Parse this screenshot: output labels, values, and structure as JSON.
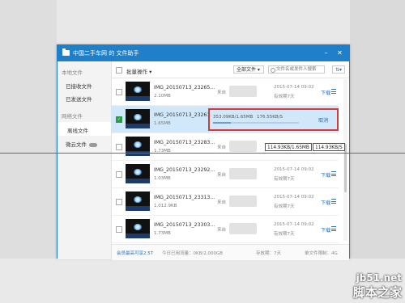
{
  "window": {
    "title": "中国二手车网 的 文件助手"
  },
  "sidebar": {
    "section_local": "本地文件",
    "received": "已接收文件",
    "sent": "已发送文件",
    "section_network": "网络文件",
    "offline": "离线文件",
    "cloud": "微云文件"
  },
  "toolbar": {
    "batch": "批量操作",
    "filter": "全部文件",
    "search_placeholder": "文件名或发件人搜索"
  },
  "rows": [
    {
      "name": "IMG_20150713_23265...",
      "size": "2.10MB",
      "sender": "来自",
      "date": "2015-07-14 09:02",
      "validity": "有效期7天",
      "action": "下载"
    },
    {
      "name": "IMG_20150713_23261...",
      "size": "1.65MB",
      "progress_text": "353.09KB/1.65MB",
      "speed": "176.55KB/S",
      "progress_fraction": 0.21,
      "action": "取消"
    },
    {
      "name": "IMG_20150713_23283...",
      "size": "1.73MB",
      "sender": "来自",
      "date": "",
      "validity": "",
      "action": "下载"
    },
    {
      "name": "IMG_20150713_23292...",
      "size": "1.03MB",
      "sender": "来自",
      "date": "2015-07-14 09:02",
      "validity": "有效期7天",
      "action": "下载"
    },
    {
      "name": "IMG_20150713_23313...",
      "size": "1,012.9KB",
      "sender": "来自",
      "date": "2015-07-14 09:02",
      "validity": "有效期7天",
      "action": "下载"
    },
    {
      "name": "IMG_20150713_23303...",
      "size": "1.73MB",
      "sender": "来自",
      "date": "2015-07-14 09:02",
      "validity": "有效期7天",
      "action": "下载"
    }
  ],
  "tooltips": [
    "114.93KB/1.65MB",
    "114.93KB/S"
  ],
  "status": {
    "vip": "会员最高可享2.5T",
    "today": "今日已用流量：0KB/2,000GB",
    "period": "存放期：7天",
    "limit": "单文件限制：4G"
  },
  "watermark": {
    "site": "jb51.net",
    "name": "脚本之家"
  }
}
